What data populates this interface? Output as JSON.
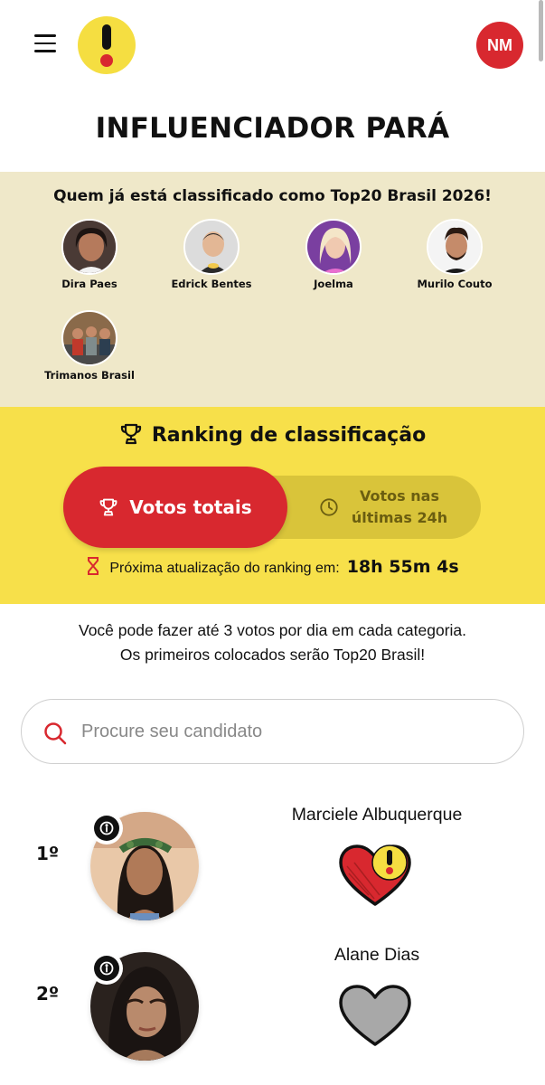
{
  "header": {
    "menu_icon": "hamburger-menu-icon",
    "logo_icon": "exclamation-logo-icon",
    "user_initials": "NM"
  },
  "page": {
    "title": "INFLUENCIADOR PARÁ"
  },
  "classified": {
    "title": "Quem já está classificado como Top20 Brasil 2026!",
    "people": [
      {
        "name": "Dira Paes"
      },
      {
        "name": "Edrick Bentes"
      },
      {
        "name": "Joelma"
      },
      {
        "name": "Murilo Couto"
      },
      {
        "name": "Trimanos Brasil"
      }
    ]
  },
  "ranking": {
    "title": "Ranking de classificação",
    "tabs": {
      "total_label": "Votos totais",
      "last24_label_line1": "Votos nas",
      "last24_label_line2": "últimas 24h"
    },
    "update_label": "Próxima atualização do ranking em:",
    "update_timer": "18h 55m 4s"
  },
  "info": {
    "line1": "Você pode fazer até 3 votos por dia em cada categoria.",
    "line2": "Os primeiros colocados serão Top20 Brasil!"
  },
  "search": {
    "placeholder": "Procure seu candidato"
  },
  "candidates": [
    {
      "rank": "1º",
      "name": "Marciele Albuquerque",
      "voted": true
    },
    {
      "rank": "2º",
      "name": "Alane Dias",
      "voted": false
    }
  ],
  "colors": {
    "brand_red": "#d8282f",
    "brand_yellow": "#f7e04a",
    "cream": "#efe8c9",
    "toggle_inactive": "#d9c43a",
    "heart_inactive": "#a8a8a8"
  }
}
